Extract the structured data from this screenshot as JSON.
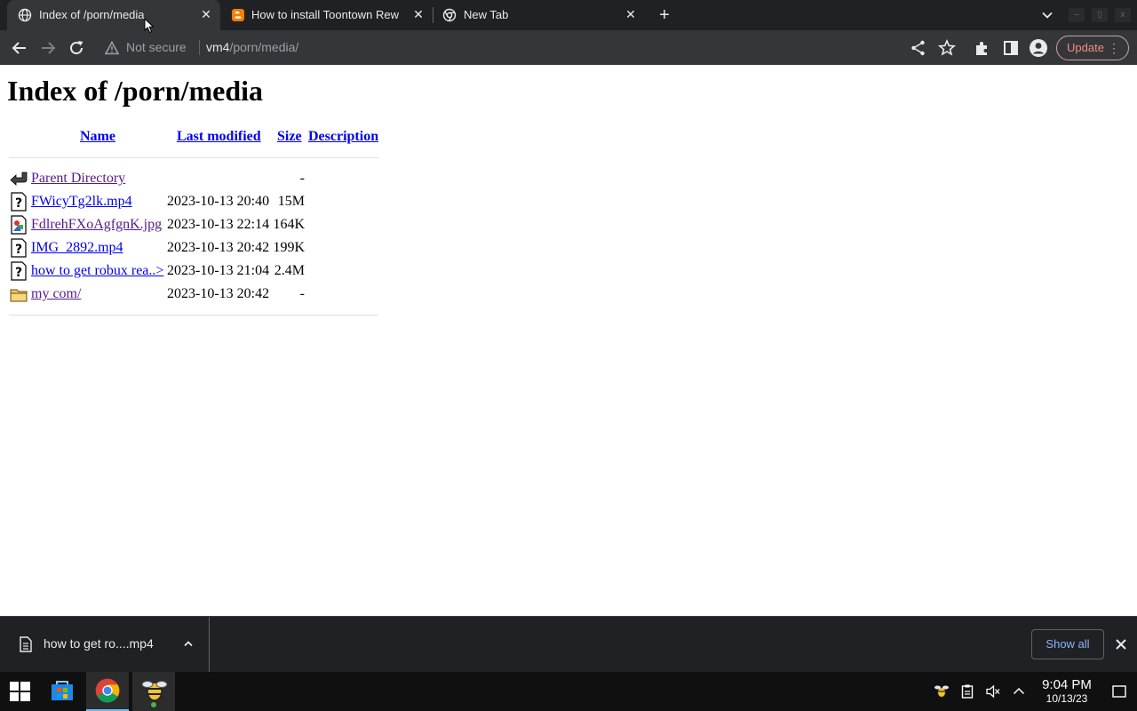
{
  "tabs": [
    {
      "title": "Index of /porn/media",
      "active": true,
      "icon": "globe-icon"
    },
    {
      "title": "How to install Toontown Rew",
      "active": false,
      "icon": "blogger-icon"
    },
    {
      "title": "New Tab",
      "active": false,
      "icon": "chrome-icon"
    }
  ],
  "toolbar": {
    "security_label": "Not secure",
    "url_host": "vm4",
    "url_path": "/porn/media/",
    "update_label": "Update"
  },
  "page": {
    "heading": "Index of /porn/media",
    "columns": {
      "name": "Name",
      "modified": "Last modified",
      "size": "Size",
      "description": "Description"
    },
    "entries": [
      {
        "icon": "back-arrow-icon",
        "name": "Parent Directory",
        "date": "",
        "size": "-",
        "visited": true
      },
      {
        "icon": "unknown-file-icon",
        "name": "FWicyTg2lk.mp4",
        "date": "2023-10-13 20:40",
        "size": "15M",
        "visited": false
      },
      {
        "icon": "image-file-icon",
        "name": "FdlrehFXoAgfgnK.jpg",
        "date": "2023-10-13 22:14",
        "size": "164K",
        "visited": true
      },
      {
        "icon": "unknown-file-icon",
        "name": "IMG_2892.mp4",
        "date": "2023-10-13 20:42",
        "size": "199K",
        "visited": false
      },
      {
        "icon": "unknown-file-icon",
        "name": "how to get robux rea..>",
        "date": "2023-10-13 21:04",
        "size": "2.4M",
        "visited": false
      },
      {
        "icon": "folder-icon",
        "name": "my com/",
        "date": "2023-10-13 20:42",
        "size": "-",
        "visited": true
      }
    ]
  },
  "downloads": {
    "file_name": "how to get ro....mp4",
    "show_all_label": "Show all"
  },
  "taskbar": {
    "time": "9:04 PM",
    "date": "10/13/23"
  },
  "colors": {
    "link": "#0000ee",
    "visited": "#551a8b",
    "chrome_dark": "#202124",
    "chrome_toolbar": "#35363a",
    "update_accent": "#f28b82"
  }
}
